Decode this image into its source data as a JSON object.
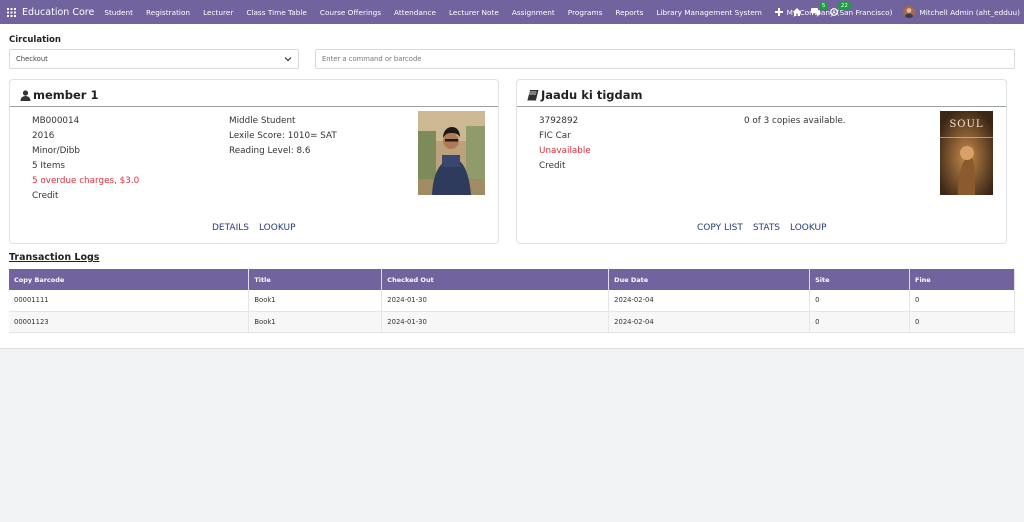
{
  "navbar": {
    "brand": "Education Core",
    "menu": [
      "Student",
      "Registration",
      "Lecturer",
      "Class Time Table",
      "Course Offerings",
      "Attendance",
      "Lecturer Note",
      "Assignment",
      "Programs",
      "Reports",
      "Library Management System"
    ],
    "messages_badge": "5",
    "activity_badge": "22",
    "company": "My Company (San Francisco)",
    "user": "Mitchell Admin (aht_edduu)"
  },
  "circulation": {
    "title": "Circulation",
    "mode_selected": "Checkout",
    "command_placeholder": "Enter a command or barcode"
  },
  "member": {
    "name": "member 1",
    "left_lines": {
      "id": "MB000014",
      "year": "2016",
      "group": "Minor/Dibb",
      "items": "5 Items",
      "overdue": "5 overdue charges, $3.0",
      "payment": "Credit"
    },
    "right_lines": {
      "type": "Middle Student",
      "lexile": "Lexile Score: 1010= SAT",
      "reading": "Reading Level: 8.6"
    },
    "links": {
      "details": "DETAILS",
      "lookup": "LOOKUP"
    }
  },
  "book": {
    "title": "Jaadu ki tigdam",
    "left_lines": {
      "barcode": "3792892",
      "category": "FIC Car",
      "status": "Unavailable",
      "payment": "Credit"
    },
    "availability": "0 of 3 copies available.",
    "cover_text": "SOUL",
    "links": {
      "copy_list": "COPY LIST",
      "stats": "STATS",
      "lookup": "LOOKUP"
    }
  },
  "logs": {
    "title": "Transaction Logs",
    "columns": [
      "Copy Barcode",
      "Title",
      "Checked Out",
      "Due Date",
      "Site",
      "Fine"
    ],
    "rows": [
      [
        "00001111",
        "Book1",
        "2024-01-30",
        "2024-02-04",
        "0",
        "0"
      ],
      [
        "00001123",
        "Book1",
        "2024-01-30",
        "2024-02-04",
        "0",
        "0"
      ]
    ]
  },
  "colors": {
    "navbar": "#71639e",
    "overdue": "#d9303f",
    "link": "#283c73"
  }
}
